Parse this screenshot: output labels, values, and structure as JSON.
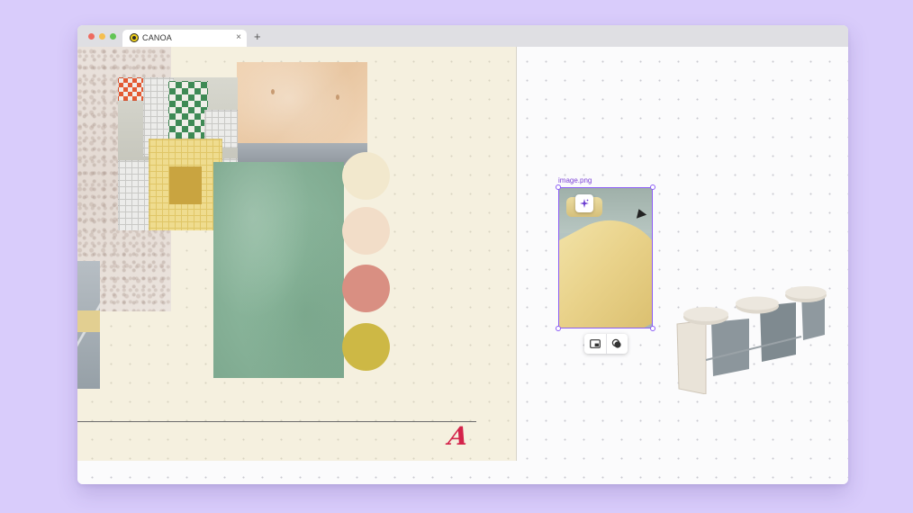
{
  "window": {
    "tab_title": "CANOA",
    "tab_close": "×",
    "new_tab": "+"
  },
  "canvas": {
    "selected_image_label": "image.png"
  },
  "board": {
    "swatches": [
      "#f2e8cd",
      "#f2ddc8",
      "#d98f82",
      "#cdb845"
    ],
    "logo_text": "A",
    "logo_color": "#d4234a"
  },
  "colors": {
    "desktop": "#d9ccfb",
    "selection": "#8b5cf6",
    "board_background": "#f5f0df"
  },
  "icons": {
    "sparkle": "sparkle-icon",
    "picture_in_picture": "picture-in-picture-icon",
    "layers": "layers-icon"
  }
}
